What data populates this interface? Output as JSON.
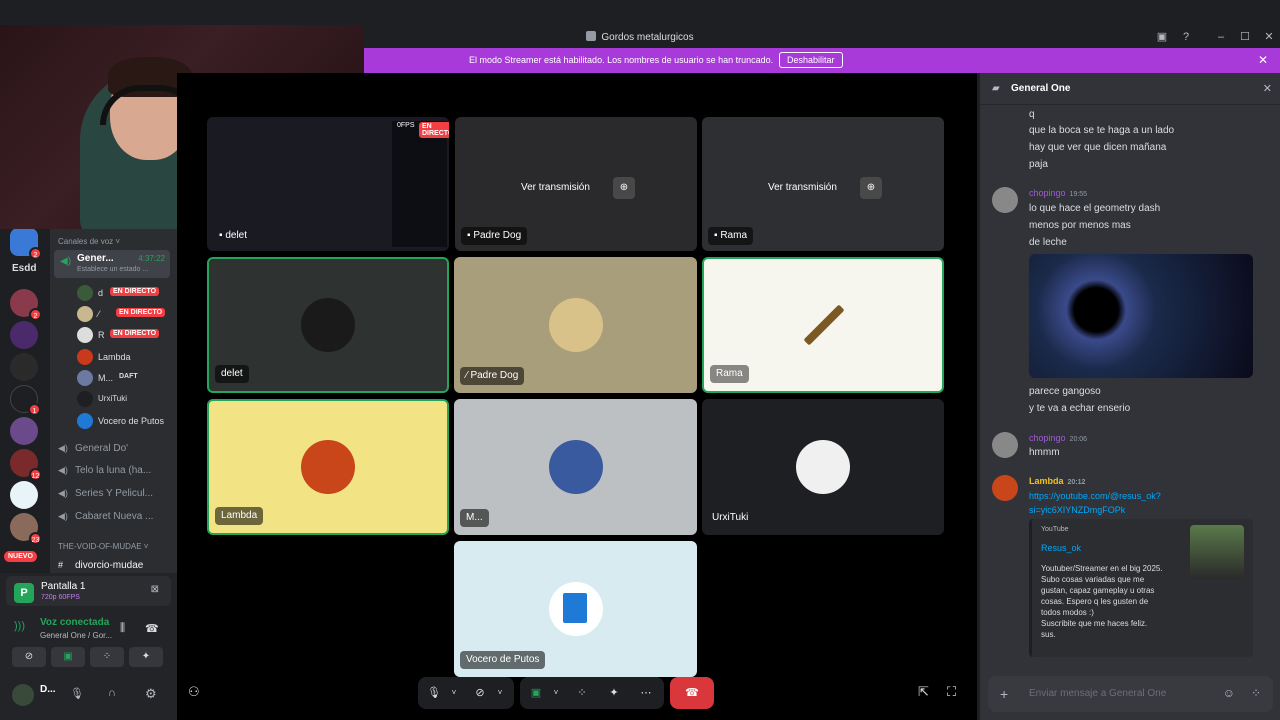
{
  "window": {
    "title": "Gordos metalurgicos"
  },
  "banner": {
    "text": "El modo Streamer está habilitado. Los nombres de usuario se han truncado.",
    "button": "Deshabilitar"
  },
  "rail": {
    "server_text": "Esdd",
    "badges": [
      "2",
      "2",
      "1",
      "12",
      "23"
    ],
    "nuevo": "NUEVO"
  },
  "sidebar": {
    "category_voice": "Canales de voz",
    "active_channel": {
      "name": "Gener...",
      "time": "4:37:22",
      "status": "Establece un estado ..."
    },
    "users": [
      {
        "name": "d",
        "live": "EN DIRECTO"
      },
      {
        "name": "",
        "live": "EN DIRECTO"
      },
      {
        "name": "R",
        "live": "EN DIRECTO"
      },
      {
        "name": "Lambda",
        "live": ""
      },
      {
        "name": "M...",
        "tag": "DAFT"
      },
      {
        "name": "UrxiTuki"
      },
      {
        "name": "Vocero de Putos"
      }
    ],
    "channels": [
      "General Do'",
      "Telo la luna (ha...",
      "Series Y Pelicul...",
      "Cabaret Nueva ..."
    ],
    "category_void": "THE-VOID-OF-MUDAE",
    "text_channel": "divorcio-mudae"
  },
  "panel": {
    "stream_name": "Pantalla 1",
    "stream_quality": "720p 60FPS",
    "voice_status": "Voz conectada",
    "voice_channel": "General One / Gor...",
    "user_short": "D..."
  },
  "tiles": {
    "stream1_label": "delet",
    "stream1_live": "EN DIRECTO",
    "stream1_fps": "0FPS",
    "stream2_label": "Padre Dog",
    "stream3_label": "Rama",
    "watch_label": "Ver transmisión",
    "t_delet": "delet",
    "t_padre": "Padre Dog",
    "t_rama": "Rama",
    "t_lambda": "Lambda",
    "t_m": "M...",
    "t_urxi": "UrxiTuki",
    "t_vocero": "Vocero de Putos"
  },
  "chat": {
    "channel": "General One",
    "lines_top": [
      "q",
      "que la boca se te haga a un lado",
      "hay que ver que dicen mañana",
      "paja"
    ],
    "msg1": {
      "author": "chopingo",
      "time": "19:55",
      "lines": [
        "lo que hace el geometry dash",
        "menos por menos mas",
        "de leche"
      ]
    },
    "lines_after_image": [
      "parece gangoso",
      "y te va a echar enserio"
    ],
    "msg2": {
      "author": "chopingo",
      "time": "20:06",
      "text": "hmmm"
    },
    "msg3": {
      "author": "Lambda",
      "time": "20:12",
      "link1": "https://youtube.com/@resus_ok?",
      "link2": "si=yic6XIYNZDmgFOPk"
    },
    "embed": {
      "provider": "YouTube",
      "title": "Resus_ok",
      "desc": [
        "Youtuber/Streamer en el big 2025.",
        "Subo cosas variadas que me",
        "gustan, capaz gameplay u otras",
        "cosas. Espero q les gusten de",
        "todos modos :)",
        "Suscribite que me haces feliz.",
        "sus."
      ]
    },
    "input_placeholder": "Enviar mensaje a General One"
  },
  "colors": {
    "banner": "#a83ad9",
    "live": "#f23f43",
    "speaking": "#23a55a",
    "link": "#00a8fc",
    "chopingo": "#a05cd6",
    "lambda": "#f0c419"
  }
}
